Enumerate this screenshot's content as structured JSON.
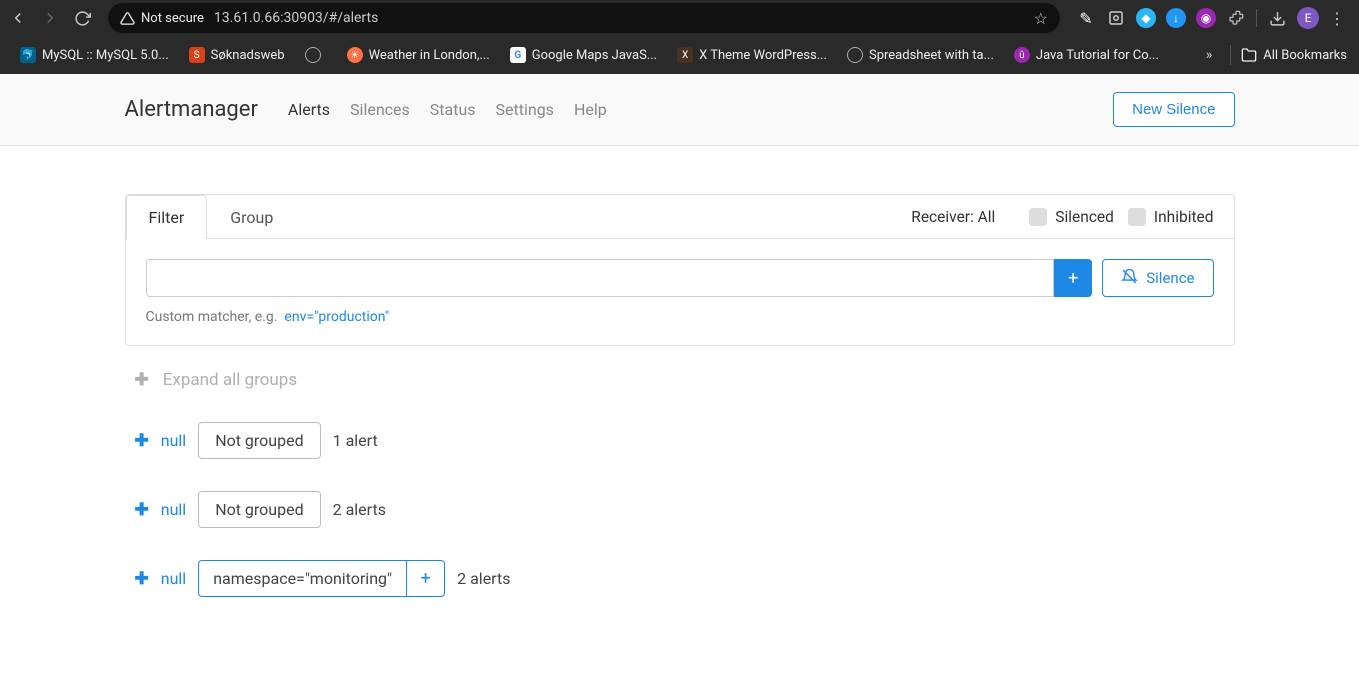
{
  "browser": {
    "url": "13.61.0.66:30903/#/alerts",
    "not_secure": "Not secure",
    "avatar_letter": "E",
    "all_bookmarks": "All Bookmarks",
    "bookmarks": [
      {
        "label": "MySQL :: MySQL 5.0..."
      },
      {
        "label": "Søknadsweb"
      },
      {
        "label": ""
      },
      {
        "label": "Weather in London,..."
      },
      {
        "label": "Google Maps JavaS..."
      },
      {
        "label": "X Theme WordPress..."
      },
      {
        "label": "Spreadsheet with ta..."
      },
      {
        "label": "Java Tutorial for Co..."
      }
    ]
  },
  "app": {
    "brand": "Alertmanager",
    "nav": {
      "alerts": "Alerts",
      "silences": "Silences",
      "status": "Status",
      "settings": "Settings",
      "help": "Help"
    },
    "new_silence": "New Silence"
  },
  "filter": {
    "tab_filter": "Filter",
    "tab_group": "Group",
    "receiver_label": "Receiver: All",
    "silenced": "Silenced",
    "inhibited": "Inhibited",
    "input_value": "",
    "hint_prefix": "Custom matcher, e.g.",
    "hint_example": "env=\"production\"",
    "silence_btn": "Silence"
  },
  "expand_all": "Expand all groups",
  "groups": [
    {
      "null": "null",
      "tag": "Not grouped",
      "tag_split": false,
      "count": "1 alert"
    },
    {
      "null": "null",
      "tag": "Not grouped",
      "tag_split": false,
      "count": "2 alerts"
    },
    {
      "null": "null",
      "tag": "namespace=\"monitoring\"",
      "tag_split": true,
      "count": "2 alerts"
    }
  ]
}
